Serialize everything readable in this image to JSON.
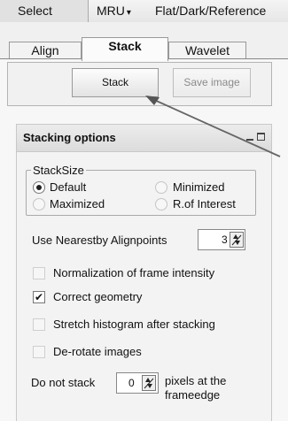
{
  "menu": {
    "items": [
      "Select",
      "MRU",
      "Flat/Dark/Reference"
    ],
    "dropdown_glyph": "▾"
  },
  "tabs": [
    "Align",
    "Stack",
    "Wavelet"
  ],
  "active_tab": "Stack",
  "toolbar": {
    "stack_label": "Stack",
    "save_label": "Save image"
  },
  "panel": {
    "title": "Stacking options",
    "stacksize": {
      "legend": "StackSize",
      "options": [
        "Default",
        "Minimized",
        "Maximized",
        "R.of Interest"
      ],
      "selected": "Default"
    },
    "nearest": {
      "label": "Use Nearestby Alignpoints",
      "value": "3"
    },
    "checks": [
      {
        "label": "Normalization of frame intensity",
        "checked": false
      },
      {
        "label": "Correct geometry",
        "checked": true
      },
      {
        "label": "Stretch histogram after stacking",
        "checked": false
      },
      {
        "label": "De-rotate images",
        "checked": false
      }
    ],
    "donotstack": {
      "label": "Do not stack",
      "value": "0",
      "suffix": "pixels at the frameedge"
    }
  },
  "icons": {
    "menu_dropdown": "chevron-down-icon",
    "pin": "pin-icon",
    "maximize": "maximize-icon",
    "spinner": "spinner-arrows-icon",
    "pointer": "arrow-pointer-icon"
  }
}
